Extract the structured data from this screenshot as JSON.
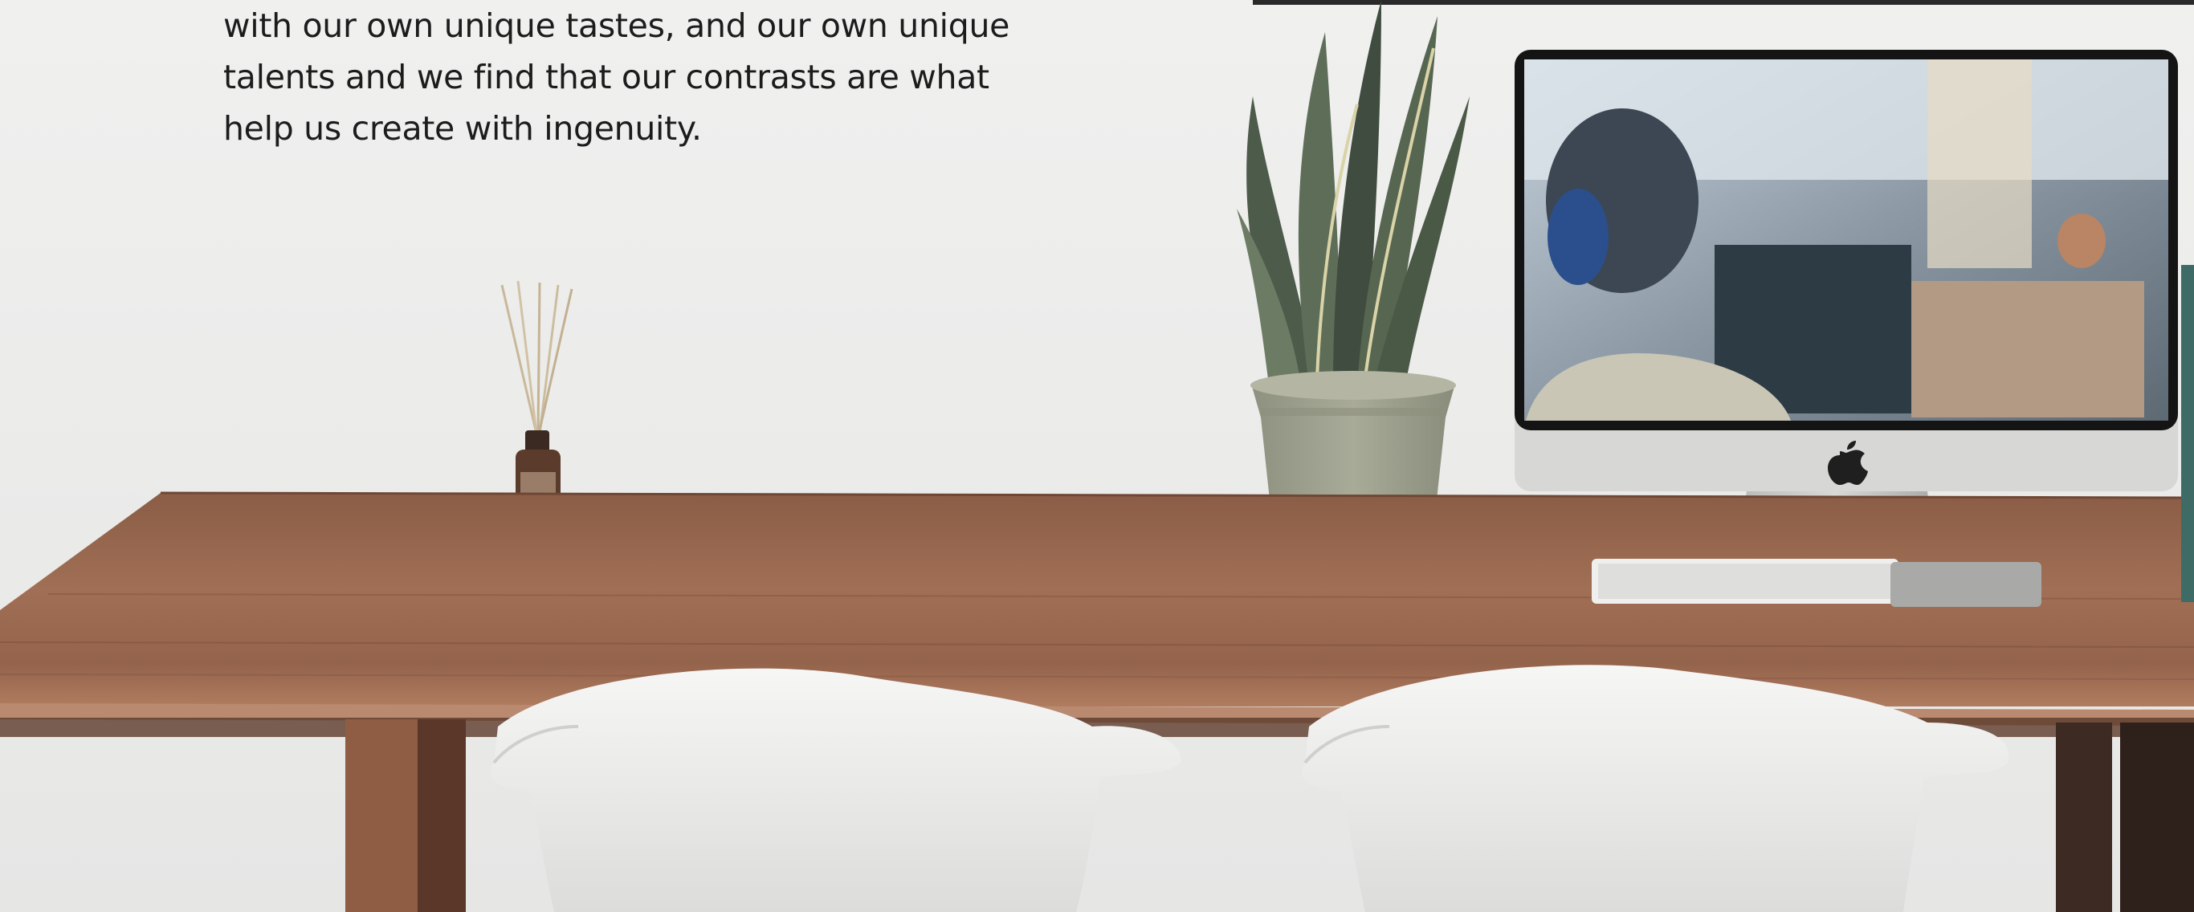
{
  "hero": {
    "text_lines": [
      "with our own unique tastes, and our own unique",
      "talents and we find that our contrasts are what",
      "help us create with ingenuity."
    ]
  },
  "colors": {
    "wall": "#ececeb",
    "desk_top": "#8a5a42",
    "desk_edge": "#9c6a4f",
    "pot": "#a4a692",
    "chair": "#f1f1f0",
    "monitor_frame": "#1a1a1a"
  }
}
